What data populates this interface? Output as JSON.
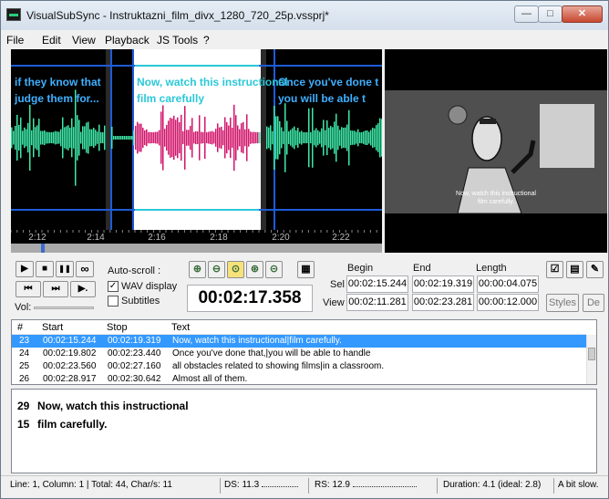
{
  "window": {
    "title": "VisualSubSync - Instruktazni_film_divx_1280_720_25p.vssprj*",
    "minimize_glyph": "—",
    "maximize_glyph": "□",
    "close_glyph": "✕"
  },
  "menu": [
    "File",
    "Edit",
    "View",
    "Playback",
    "JS Tools",
    "?"
  ],
  "waveform": {
    "subtitle_blocks": [
      {
        "line1": "if they know that",
        "line2": "judge them for..."
      },
      {
        "line1": "Now, watch this instructional",
        "line2": "film carefully"
      },
      {
        "line1": "Once you've done t",
        "line2": "you will be able t"
      }
    ],
    "time_ticks": [
      "2:12",
      "2:14",
      "2:16",
      "2:18",
      "2:20",
      "2:22"
    ],
    "colors": {
      "wave": "#3ee8a8",
      "selected_wave": "#d0156b",
      "marker": "#1e5bd8",
      "subtitle_text": "#3fb0ff",
      "selected_subtitle_text": "#2ac8d8"
    }
  },
  "video": {
    "caption_line1": "Now, watch this instructional",
    "caption_line2": "film carefully."
  },
  "controls": {
    "play_icon": "▶",
    "stop_icon": "■",
    "pause_icon": "❚❚",
    "loop_icon": "∞",
    "prev_icon": "⏮",
    "next_icon": "⏭",
    "play_to_end_icon": "▶.",
    "vol_label": "Vol:",
    "autoscroll_label": "Auto-scroll :",
    "wav_display_label": "WAV display",
    "wav_display_checked": true,
    "subtitles_label": "Subtitles",
    "subtitles_checked": false,
    "current_time": "00:02:17.358"
  },
  "timing": {
    "headers": {
      "begin": "Begin",
      "end": "End",
      "length": "Length"
    },
    "sel_label": "Sel",
    "view_label": "View",
    "sel": {
      "begin": "00:02:15.244",
      "end": "00:02:19.319",
      "length": "00:00:04.075"
    },
    "view": {
      "begin": "00:02:11.281",
      "end": "00:02:23.281",
      "length": "00:00:12.000"
    }
  },
  "side_buttons": {
    "styles": "Styles",
    "de": "De"
  },
  "grid": {
    "columns": [
      "#",
      "Start",
      "Stop",
      "Text"
    ],
    "rows": [
      {
        "num": "23",
        "start": "00:02:15.244",
        "stop": "00:02:19.319",
        "text": "Now, watch this instructional|film carefully.",
        "selected": true
      },
      {
        "num": "24",
        "start": "00:02:19.802",
        "stop": "00:02:23.440",
        "text": "Once you've done that,|you will be able to handle",
        "selected": false
      },
      {
        "num": "25",
        "start": "00:02:23.560",
        "stop": "00:02:27.160",
        "text": "all obstacles related to showing films|in a classroom.",
        "selected": false
      },
      {
        "num": "26",
        "start": "00:02:28.917",
        "stop": "00:02:30.642",
        "text": "Almost all of them.",
        "selected": false
      }
    ]
  },
  "editor": {
    "line1_count": "29",
    "line1_text": "Now, watch this instructional",
    "line2_count": "15",
    "line2_text": "film carefully."
  },
  "status": {
    "position": "Line: 1, Column: 1 | Total: 44, Char/s: 11",
    "ds": "DS: 11.3",
    "rs": "RS: 12.9",
    "duration": "Duration: 4.1 (ideal: 2.8)",
    "quality": "A bit slow."
  }
}
